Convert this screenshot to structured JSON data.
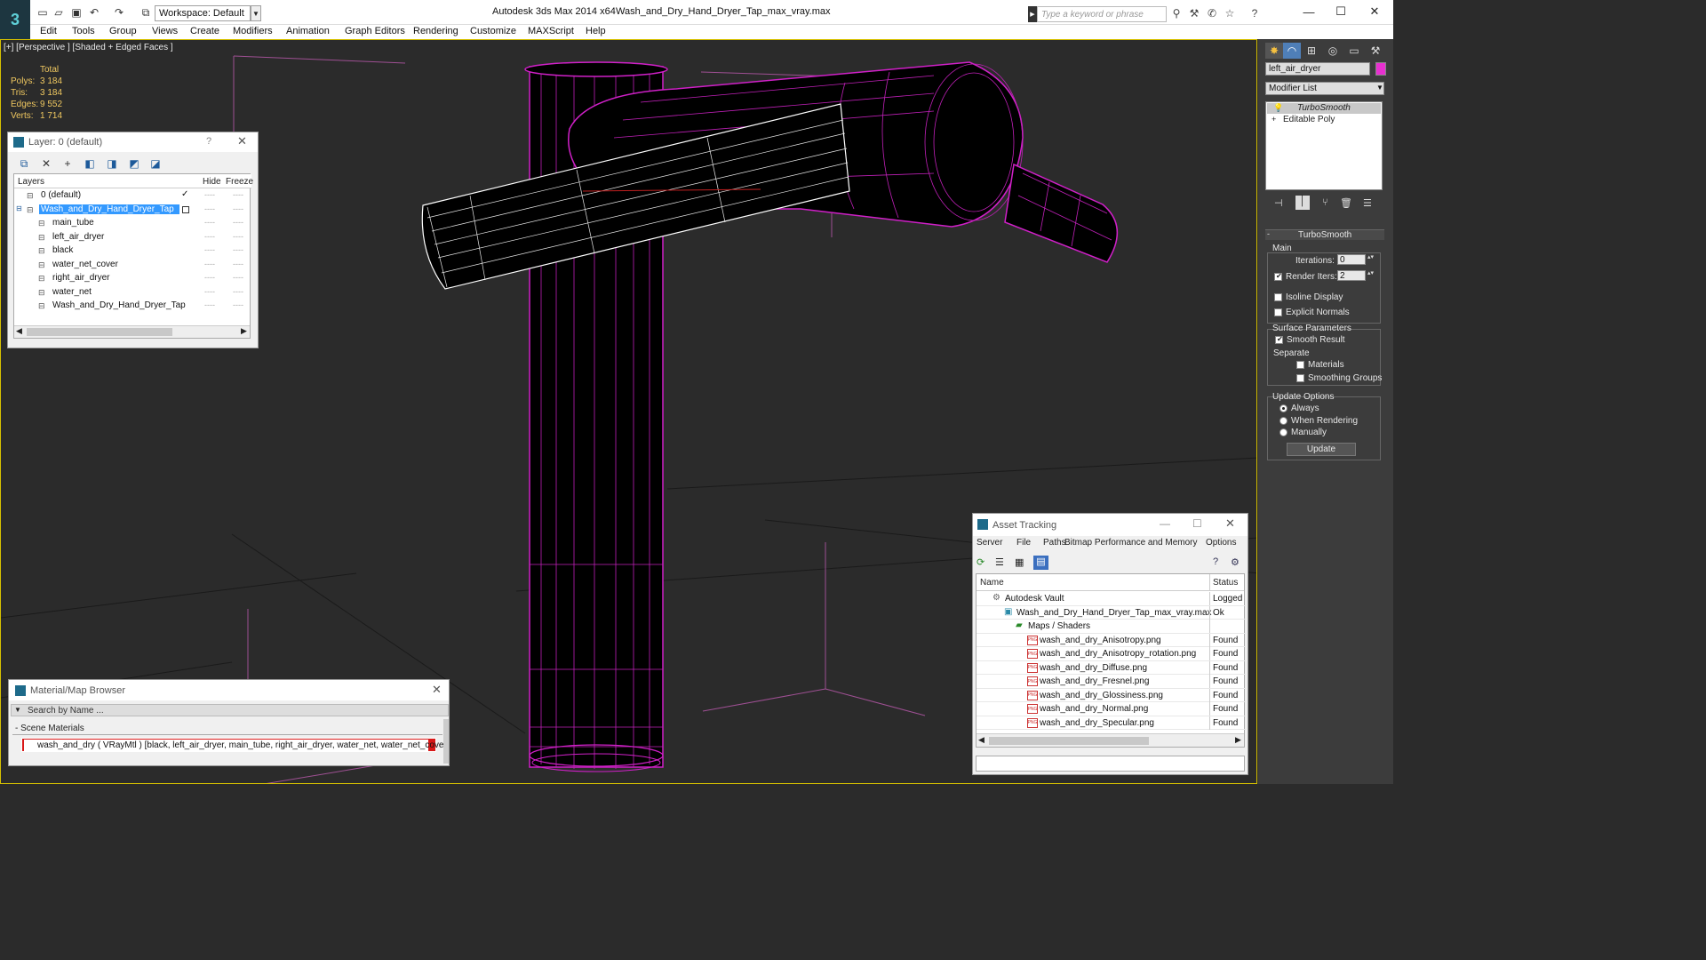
{
  "app": {
    "logo": "3",
    "title": "Autodesk 3ds Max  2014 x64",
    "file": "Wash_and_Dry_Hand_Dryer_Tap_max_vray.max",
    "workspace": "Workspace: Default",
    "search_placeholder": "Type a keyword or phrase"
  },
  "menu": [
    "Edit",
    "Tools",
    "Group",
    "Views",
    "Create",
    "Modifiers",
    "Animation",
    "Graph Editors",
    "Rendering",
    "Customize",
    "MAXScript",
    "Help"
  ],
  "viewport": {
    "label": "[+] [Perspective ] [Shaded + Edged Faces ]",
    "stats_header": "Total",
    "stats": [
      {
        "label": "Polys:",
        "value": "3 184"
      },
      {
        "label": "Tris:",
        "value": "3 184"
      },
      {
        "label": "Edges:",
        "value": "9 552"
      },
      {
        "label": "Verts:",
        "value": "1 714"
      }
    ]
  },
  "layer_panel": {
    "title": "Layer: 0 (default)",
    "help": "?",
    "col_layers": "Layers",
    "col_hide": "Hide",
    "col_freeze": "Freeze",
    "rows": [
      {
        "name": "0 (default)",
        "level": 0,
        "selected": false
      },
      {
        "name": "Wash_and_Dry_Hand_Dryer_Tap",
        "level": 0,
        "selected": true
      },
      {
        "name": "main_tube",
        "level": 1,
        "selected": false
      },
      {
        "name": "left_air_dryer",
        "level": 1,
        "selected": false
      },
      {
        "name": "black",
        "level": 1,
        "selected": false
      },
      {
        "name": "water_net_cover",
        "level": 1,
        "selected": false
      },
      {
        "name": "right_air_dryer",
        "level": 1,
        "selected": false
      },
      {
        "name": "water_net",
        "level": 1,
        "selected": false
      },
      {
        "name": "Wash_and_Dry_Hand_Dryer_Tap",
        "level": 1,
        "selected": false
      }
    ]
  },
  "material_browser": {
    "title": "Material/Map Browser",
    "search_placeholder": "Search by Name ...",
    "section": "- Scene Materials",
    "item": "wash_and_dry  ( VRayMtl )  [black, left_air_dryer, main_tube, right_air_dryer, water_net, water_net_cover]"
  },
  "command_panel": {
    "object_name": "left_air_dryer",
    "object_color": "#e830d0",
    "modifier_list": "Modifier List",
    "stack": [
      "TurboSmooth",
      "Editable Poly"
    ],
    "rollout_title": "TurboSmooth",
    "main_label": "Main",
    "iterations_label": "Iterations:",
    "iterations_value": "0",
    "render_iters_label": "Render Iters:",
    "render_iters_value": "2",
    "isoline": "Isoline Display",
    "explicit_normals": "Explicit Normals",
    "surface_params": "Surface Parameters",
    "smooth_result": "Smooth Result",
    "separate": "Separate",
    "materials": "Materials",
    "smoothing_groups": "Smoothing Groups",
    "update_options": "Update Options",
    "always": "Always",
    "when_rendering": "When Rendering",
    "manually": "Manually",
    "update_button": "Update"
  },
  "asset_tracking": {
    "title": "Asset Tracking",
    "menu": [
      "Server",
      "File",
      "Paths",
      "Bitmap Performance and Memory",
      "Options"
    ],
    "col_name": "Name",
    "col_status": "Status",
    "rows": [
      {
        "name": "Autodesk Vault",
        "status": "Logged",
        "level": 0,
        "icon": "vault"
      },
      {
        "name": "Wash_and_Dry_Hand_Dryer_Tap_max_vray.max",
        "status": "Ok",
        "level": 1,
        "icon": "max"
      },
      {
        "name": "Maps / Shaders",
        "status": "",
        "level": 2,
        "icon": "maps"
      },
      {
        "name": "wash_and_dry_Anisotropy.png",
        "status": "Found",
        "level": 3,
        "icon": "png"
      },
      {
        "name": "wash_and_dry_Anisotropy_rotation.png",
        "status": "Found",
        "level": 3,
        "icon": "png"
      },
      {
        "name": "wash_and_dry_Diffuse.png",
        "status": "Found",
        "level": 3,
        "icon": "png"
      },
      {
        "name": "wash_and_dry_Fresnel.png",
        "status": "Found",
        "level": 3,
        "icon": "png"
      },
      {
        "name": "wash_and_dry_Glossiness.png",
        "status": "Found",
        "level": 3,
        "icon": "png"
      },
      {
        "name": "wash_and_dry_Normal.png",
        "status": "Found",
        "level": 3,
        "icon": "png"
      },
      {
        "name": "wash_and_dry_Specular.png",
        "status": "Found",
        "level": 3,
        "icon": "png"
      }
    ]
  },
  "colors": {
    "wire": "#d020c8",
    "selected_wire": "#ffffff",
    "viewport_bg": "#2b2b2b",
    "stats": "#f0c860",
    "selection_blue": "#3399ff"
  }
}
